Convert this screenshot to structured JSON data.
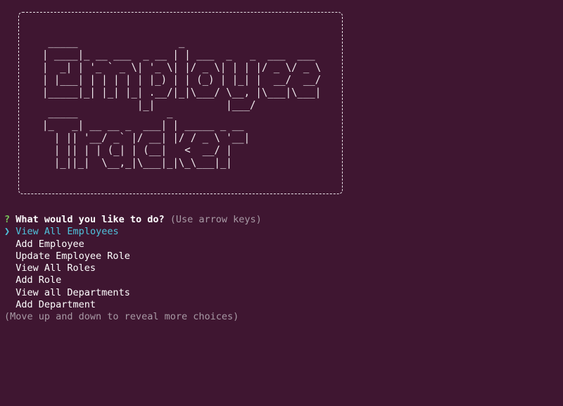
{
  "banner": {
    "title_line_1": "Employee",
    "title_line_2": "Tracker",
    "ascii_employee": " _____                 _\n| ____|_ __ ___  _ __ | | ___  _   _  ___  ___\n|  _| | '_ ` _ \\| '_ \\| |/ _ \\| | | |/ _ \\/ _ \\\n| |___| | | | | | |_) | | (_) | |_| |  __/  __/\n|_____|_| |_| |_| .__/|_|\\___/ \\__, |\\___|\\___|\n                |_|            |___/",
    "ascii_tracker": " _____               _\n|_   _| __ __ _  ___| | _____ _ __\n  | || '__/ _` |/ __| |/ / _ \\ '__|\n  | || | | (_| | (__|   <  __/ |\n  |_||_|  \\__,_|\\___|_|\\_\\___|_|"
  },
  "prompt": {
    "qmark": "?",
    "question": "What would you like to do?",
    "hint": "(Use arrow keys)",
    "pointer": "❯",
    "choices": [
      {
        "label": "View All Employees",
        "selected": true
      },
      {
        "label": "Add Employee",
        "selected": false
      },
      {
        "label": "Update Employee Role",
        "selected": false
      },
      {
        "label": "View All Roles",
        "selected": false
      },
      {
        "label": "Add Role",
        "selected": false
      },
      {
        "label": "View all Departments",
        "selected": false
      },
      {
        "label": "Add Department",
        "selected": false
      }
    ],
    "footer": "(Move up and down to reveal more choices)"
  },
  "colors": {
    "background": "#3f1631",
    "selected": "#4fc3dd",
    "qmark": "#78c55a",
    "hint": "#a89aa5"
  }
}
